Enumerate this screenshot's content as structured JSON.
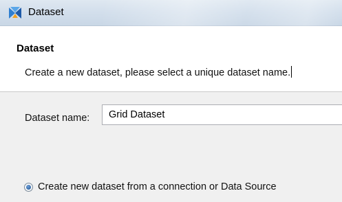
{
  "window": {
    "title": "Dataset",
    "icon": "dataset-wizard-icon"
  },
  "header": {
    "title": "Dataset",
    "description": "Create a new dataset, please select a unique dataset name."
  },
  "form": {
    "dataset_name_label": "Dataset name:",
    "dataset_name_value": "Grid Dataset"
  },
  "options": {
    "radio_label": "Create new dataset from a connection or Data Source",
    "radio_selected": true
  },
  "colors": {
    "titlebar": "#d3dfec",
    "header_bg": "#ffffff",
    "body_bg": "#f0f0f0"
  }
}
